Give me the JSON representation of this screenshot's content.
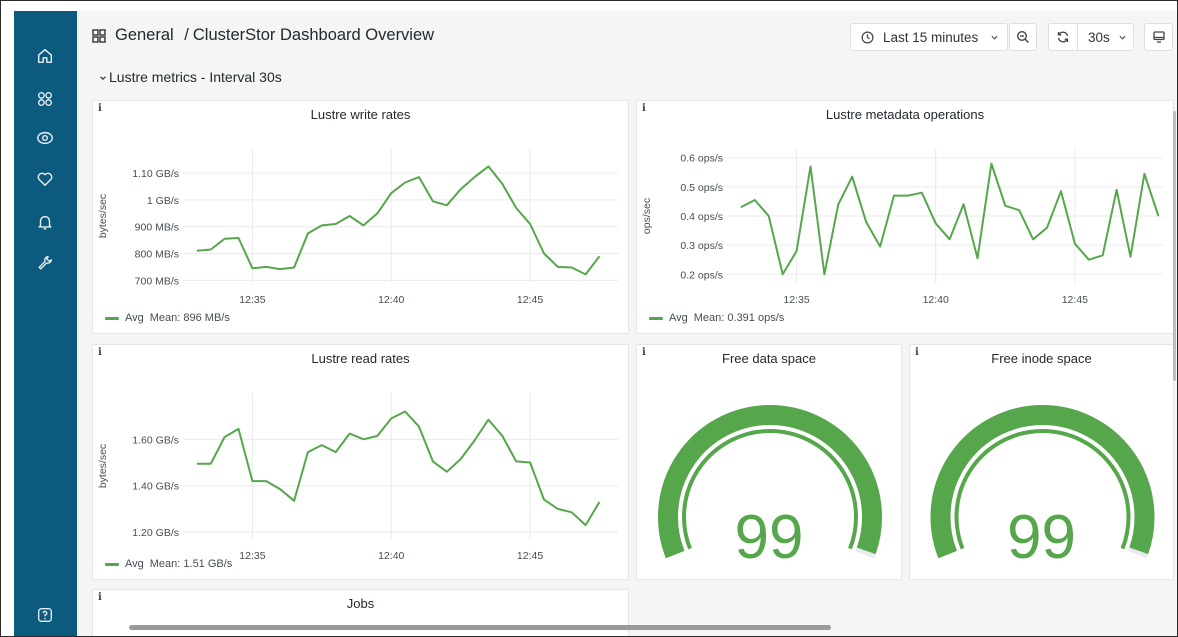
{
  "sidebar": {
    "items": [
      {
        "icon": "home-icon"
      },
      {
        "icon": "dashboards-icon"
      },
      {
        "icon": "explore-icon"
      },
      {
        "icon": "alerting-icon"
      },
      {
        "icon": "notifications-icon"
      },
      {
        "icon": "admin-icon"
      }
    ],
    "help_icon": "help-icon"
  },
  "header": {
    "folder": "General",
    "separator": "/",
    "dashboard": "ClusterStor Dashboard Overview",
    "time_range": "Last 15 minutes",
    "refresh_interval": "30s"
  },
  "row": {
    "title": "Lustre metrics - Interval 30s"
  },
  "colors": {
    "sidebar": "#0c5a7d",
    "series": "#56a64b",
    "background": "#f4f5f5"
  },
  "panels": {
    "write": {
      "title": "Lustre write rates",
      "legend_name": "Avg",
      "legend_stat": "Mean: 896 MB/s",
      "info": "i"
    },
    "metadata": {
      "title": "Lustre metadata operations",
      "legend_name": "Avg",
      "legend_stat": "Mean: 0.391 ops/s",
      "info": "i"
    },
    "read": {
      "title": "Lustre read rates",
      "legend_name": "Avg",
      "legend_stat": "Mean: 1.51 GB/s",
      "info": "i"
    },
    "free_data": {
      "title": "Free data space",
      "value": "99",
      "percent": 99,
      "info": "i"
    },
    "free_inode": {
      "title": "Free inode space",
      "value": "99",
      "percent": 99,
      "info": "i"
    },
    "jobs": {
      "title": "Jobs",
      "info": "i"
    }
  },
  "chart_data": [
    {
      "id": "write",
      "type": "line",
      "title": "Lustre write rates",
      "ylabel": "bytes/sec",
      "x_ticks": [
        "12:35",
        "12:40",
        "12:45"
      ],
      "y_ticks": [
        "700 MB/s",
        "800 MB/s",
        "900 MB/s",
        "1 GB/s",
        "1.10 GB/s"
      ],
      "y_tick_values": [
        700,
        800,
        900,
        1000,
        1100
      ],
      "y_unit": "MB/s",
      "ylim": [
        690,
        1190
      ],
      "x": [
        "12:33:00",
        "12:33:30",
        "12:34:00",
        "12:34:30",
        "12:35:00",
        "12:35:30",
        "12:36:00",
        "12:36:30",
        "12:37:00",
        "12:37:30",
        "12:38:00",
        "12:38:30",
        "12:39:00",
        "12:39:30",
        "12:40:00",
        "12:40:30",
        "12:41:00",
        "12:41:30",
        "12:42:00",
        "12:42:30",
        "12:43:00",
        "12:43:30",
        "12:44:00",
        "12:44:30",
        "12:45:00",
        "12:45:30",
        "12:46:00",
        "12:46:30",
        "12:47:00",
        "12:47:30"
      ],
      "xlim": [
        "12:32:30",
        "12:48:10"
      ],
      "series": [
        {
          "name": "Avg",
          "values": [
            810,
            815,
            855,
            858,
            745,
            750,
            742,
            748,
            875,
            905,
            910,
            940,
            905,
            950,
            1025,
            1065,
            1085,
            995,
            980,
            1040,
            1085,
            1125,
            1060,
            970,
            910,
            800,
            750,
            748,
            722,
            790
          ]
        }
      ]
    },
    {
      "id": "metadata",
      "type": "line",
      "title": "Lustre metadata operations",
      "ylabel": "ops/sec",
      "x_ticks": [
        "12:35",
        "12:40",
        "12:45"
      ],
      "y_ticks": [
        "0.2 ops/s",
        "0.3 ops/s",
        "0.4 ops/s",
        "0.5 ops/s",
        "0.6 ops/s"
      ],
      "y_tick_values": [
        0.2,
        0.3,
        0.4,
        0.5,
        0.6
      ],
      "ylim": [
        0.17,
        0.63
      ],
      "x": [
        "12:33:00",
        "12:33:30",
        "12:34:00",
        "12:34:30",
        "12:35:00",
        "12:35:30",
        "12:36:00",
        "12:36:30",
        "12:37:00",
        "12:37:30",
        "12:38:00",
        "12:38:30",
        "12:39:00",
        "12:39:30",
        "12:40:00",
        "12:40:30",
        "12:41:00",
        "12:41:30",
        "12:42:00",
        "12:42:30",
        "12:43:00",
        "12:43:30",
        "12:44:00",
        "12:44:30",
        "12:45:00",
        "12:45:30",
        "12:46:00",
        "12:46:30",
        "12:47:00",
        "12:47:30",
        "12:48:00"
      ],
      "xlim": [
        "12:32:30",
        "12:48:10"
      ],
      "series": [
        {
          "name": "Avg",
          "values": [
            0.43,
            0.455,
            0.4,
            0.2,
            0.28,
            0.57,
            0.2,
            0.44,
            0.535,
            0.38,
            0.295,
            0.47,
            0.47,
            0.48,
            0.375,
            0.32,
            0.44,
            0.255,
            0.58,
            0.435,
            0.42,
            0.32,
            0.36,
            0.485,
            0.305,
            0.25,
            0.265,
            0.49,
            0.26,
            0.545,
            0.4
          ]
        }
      ]
    },
    {
      "id": "read",
      "type": "line",
      "title": "Lustre read rates",
      "ylabel": "bytes/sec",
      "x_ticks": [
        "12:35",
        "12:40",
        "12:45"
      ],
      "y_ticks": [
        "1.20 GB/s",
        "1.40 GB/s",
        "1.60 GB/s"
      ],
      "y_tick_values": [
        1.2,
        1.4,
        1.6
      ],
      "y_unit": "GB/s",
      "ylim": [
        1.17,
        1.8
      ],
      "x": [
        "12:33:00",
        "12:33:30",
        "12:34:00",
        "12:34:30",
        "12:35:00",
        "12:35:30",
        "12:36:00",
        "12:36:30",
        "12:37:00",
        "12:37:30",
        "12:38:00",
        "12:38:30",
        "12:39:00",
        "12:39:30",
        "12:40:00",
        "12:40:30",
        "12:41:00",
        "12:41:30",
        "12:42:00",
        "12:42:30",
        "12:43:00",
        "12:43:30",
        "12:44:00",
        "12:44:30",
        "12:45:00",
        "12:45:30",
        "12:46:00",
        "12:46:30",
        "12:47:00",
        "12:47:30"
      ],
      "xlim": [
        "12:32:30",
        "12:48:10"
      ],
      "series": [
        {
          "name": "Avg",
          "values": [
            1.495,
            1.495,
            1.61,
            1.645,
            1.42,
            1.42,
            1.385,
            1.335,
            1.545,
            1.575,
            1.545,
            1.625,
            1.6,
            1.615,
            1.69,
            1.72,
            1.655,
            1.505,
            1.46,
            1.515,
            1.595,
            1.685,
            1.615,
            1.505,
            1.5,
            1.34,
            1.3,
            1.285,
            1.23,
            1.33
          ]
        }
      ]
    }
  ]
}
